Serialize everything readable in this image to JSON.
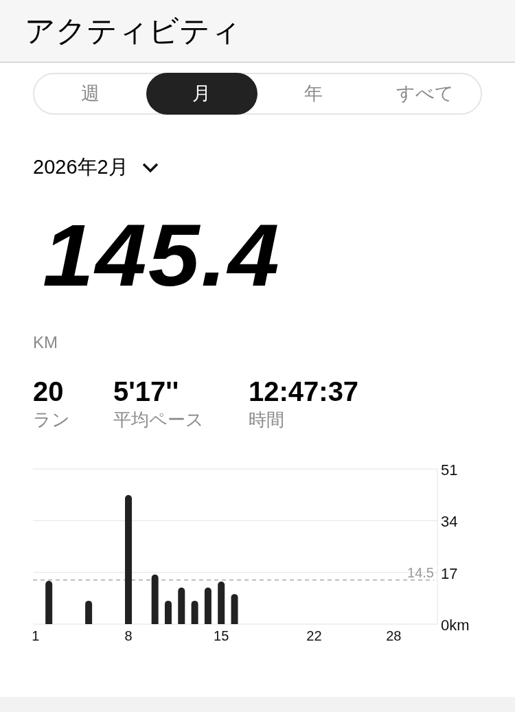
{
  "header": {
    "title": "アクティビティ"
  },
  "tabs": [
    {
      "label": "週",
      "selected": false
    },
    {
      "label": "月",
      "selected": true
    },
    {
      "label": "年",
      "selected": false
    },
    {
      "label": "すべて",
      "selected": false
    }
  ],
  "period": {
    "label": "2026年2月"
  },
  "total": {
    "value": "145.4",
    "unit": "KM"
  },
  "stats": [
    {
      "value": "20",
      "label": "ラン"
    },
    {
      "value": "5'17''",
      "label": "平均ペース"
    },
    {
      "value": "12:47:37",
      "label": "時間"
    }
  ],
  "chart_data": {
    "type": "bar",
    "x": [
      2,
      5,
      8,
      10,
      11,
      12,
      13,
      14,
      15,
      16
    ],
    "series": [
      {
        "color": "#222222",
        "values": [
          14.2,
          7.7,
          42.4,
          16.3,
          7.7,
          12.0,
          7.7,
          12.0,
          14.0,
          9.9
        ]
      }
    ],
    "xlim": [
      0.8,
      31.3
    ],
    "xticks": [
      1,
      8,
      15,
      22,
      28
    ],
    "yticks": [
      {
        "value": 0,
        "label": "0km"
      },
      17,
      34,
      51
    ],
    "ylim": [
      0,
      51
    ],
    "ref_lines": [
      {
        "axis": "y",
        "value": 14.5,
        "label": "14.5"
      }
    ]
  }
}
